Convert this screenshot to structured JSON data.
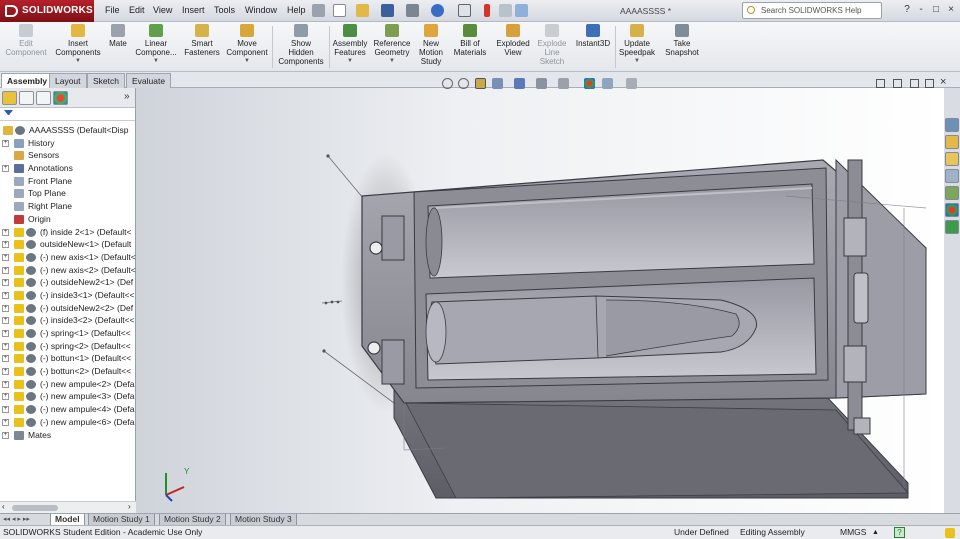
{
  "app": {
    "brand": "SOLIDWORKS",
    "document_title": "AAAASSSS *"
  },
  "menu": [
    "File",
    "Edit",
    "View",
    "Insert",
    "Tools",
    "Window",
    "Help"
  ],
  "search": {
    "placeholder": "Search SOLIDWORKS Help"
  },
  "window_controls": [
    "?",
    "-",
    "□",
    "×"
  ],
  "commands": [
    {
      "id": "edit-component",
      "label": "Edit\nComponent",
      "disabled": true,
      "icon": "edit-component-icon"
    },
    {
      "id": "insert-components",
      "label": "Insert\nComponents",
      "disabled": false,
      "icon": "insert-components-icon",
      "dropdown": true
    },
    {
      "id": "mate",
      "label": "Mate",
      "disabled": false,
      "icon": "mate-icon"
    },
    {
      "id": "linear-component-pattern",
      "label": "Linear\nCompone...",
      "disabled": false,
      "icon": "linear-pattern-icon",
      "dropdown": true
    },
    {
      "id": "smart-fasteners",
      "label": "Smart\nFasteners",
      "disabled": false,
      "icon": "smart-fasteners-icon"
    },
    {
      "id": "move-component",
      "label": "Move\nComponent",
      "disabled": false,
      "icon": "move-component-icon",
      "dropdown": true
    },
    {
      "id": "show-hidden-components",
      "label": "Show\nHidden\nComponents",
      "disabled": false,
      "icon": "show-hidden-icon"
    },
    {
      "id": "assembly-features",
      "label": "Assembly\nFeatures",
      "disabled": false,
      "icon": "assembly-features-icon",
      "dropdown": true
    },
    {
      "id": "reference-geometry",
      "label": "Reference\nGeometry",
      "disabled": false,
      "icon": "reference-geometry-icon",
      "dropdown": true
    },
    {
      "id": "new-motion-study",
      "label": "New\nMotion\nStudy",
      "disabled": false,
      "icon": "motion-study-icon"
    },
    {
      "id": "bill-of-materials",
      "label": "Bill of\nMaterials",
      "disabled": false,
      "icon": "bom-icon"
    },
    {
      "id": "exploded-view",
      "label": "Exploded\nView",
      "disabled": false,
      "icon": "exploded-view-icon"
    },
    {
      "id": "explode-line-sketch",
      "label": "Explode\nLine\nSketch",
      "disabled": true,
      "icon": "explode-line-icon"
    },
    {
      "id": "instant3d",
      "label": "Instant3D",
      "disabled": false,
      "icon": "instant3d-icon"
    },
    {
      "id": "update-speedpak",
      "label": "Update\nSpeedpak",
      "disabled": false,
      "icon": "speedpak-icon",
      "dropdown": true
    },
    {
      "id": "take-snapshot",
      "label": "Take\nSnapshot",
      "disabled": false,
      "icon": "snapshot-icon"
    }
  ],
  "cm_tabs": [
    {
      "label": "Assembly",
      "active": true
    },
    {
      "label": "Layout",
      "active": false
    },
    {
      "label": "Sketch",
      "active": false
    },
    {
      "label": "Evaluate",
      "active": false
    }
  ],
  "feature_tree": [
    {
      "label": "AAAASSSS  (Default<Disp",
      "icon": "assembly-icon",
      "expander": "",
      "indent": 0
    },
    {
      "label": "History",
      "icon": "history-icon",
      "expander": "+",
      "indent": 1
    },
    {
      "label": "Sensors",
      "icon": "sensors-icon",
      "expander": "",
      "indent": 1
    },
    {
      "label": "Annotations",
      "icon": "annotations-icon",
      "expander": "+",
      "indent": 1
    },
    {
      "label": "Front Plane",
      "icon": "plane-icon",
      "expander": "",
      "indent": 1
    },
    {
      "label": "Top Plane",
      "icon": "plane-icon",
      "expander": "",
      "indent": 1
    },
    {
      "label": "Right Plane",
      "icon": "plane-icon",
      "expander": "",
      "indent": 1
    },
    {
      "label": "Origin",
      "icon": "origin-icon",
      "expander": "",
      "indent": 1
    },
    {
      "label": "(f) inside 2<1> (Default<",
      "icon": "part-icon",
      "expander": "+",
      "indent": 1
    },
    {
      "label": "outsideNew<1> (Default",
      "icon": "part-icon",
      "expander": "+",
      "indent": 1
    },
    {
      "label": "(-) new axis<1> (Default<",
      "icon": "part-icon",
      "expander": "+",
      "indent": 1
    },
    {
      "label": "(-) new axis<2> (Default<",
      "icon": "part-icon",
      "expander": "+",
      "indent": 1
    },
    {
      "label": "(-) outsideNew2<1> (Def",
      "icon": "part-icon",
      "expander": "+",
      "indent": 1
    },
    {
      "label": "(-) inside3<1> (Default<<",
      "icon": "part-icon",
      "expander": "+",
      "indent": 1
    },
    {
      "label": "(-) outsideNew2<2> (Def",
      "icon": "part-icon",
      "expander": "+",
      "indent": 1
    },
    {
      "label": "(-) inside3<2> (Default<<",
      "icon": "part-icon",
      "expander": "+",
      "indent": 1
    },
    {
      "label": "(-) spring<1> (Default<<",
      "icon": "part-icon",
      "expander": "+",
      "indent": 1
    },
    {
      "label": "(-) spring<2> (Default<<",
      "icon": "part-icon",
      "expander": "+",
      "indent": 1
    },
    {
      "label": "(-) bottun<1> (Default<<",
      "icon": "part-icon",
      "expander": "+",
      "indent": 1
    },
    {
      "label": "(-) bottun<2> (Default<<",
      "icon": "part-icon",
      "expander": "+",
      "indent": 1
    },
    {
      "label": "(-) new ampule<2> (Defa",
      "icon": "part-icon",
      "expander": "+",
      "indent": 1
    },
    {
      "label": "(-) new ampule<3> (Defa",
      "icon": "part-icon",
      "expander": "+",
      "indent": 1
    },
    {
      "label": "(-) new ampule<4> (Defa",
      "icon": "part-icon",
      "expander": "+",
      "indent": 1
    },
    {
      "label": "(-) new ampule<6> (Defa",
      "icon": "part-icon",
      "expander": "+",
      "indent": 1
    },
    {
      "label": "Mates",
      "icon": "mates-icon",
      "expander": "+",
      "indent": 1
    }
  ],
  "motion_tabs": [
    {
      "label": "Model",
      "active": true
    },
    {
      "label": "Motion Study 1",
      "active": false
    },
    {
      "label": "Motion Study 2",
      "active": false
    },
    {
      "label": "Motion Study 3",
      "active": false
    }
  ],
  "triad": {
    "y_label": "Y"
  },
  "status": {
    "edition": "SOLIDWORKS Student Edition - Academic Use Only",
    "definition": "Under Defined",
    "mode": "Editing Assembly",
    "units": "MMGS",
    "units_arrow": "▲",
    "help": "?"
  },
  "colors": {
    "brand_red": "#a3151e",
    "part_yellow": "#e8c21b",
    "model_gray": "#8e8e96",
    "accent_blue": "#2a5db0"
  }
}
